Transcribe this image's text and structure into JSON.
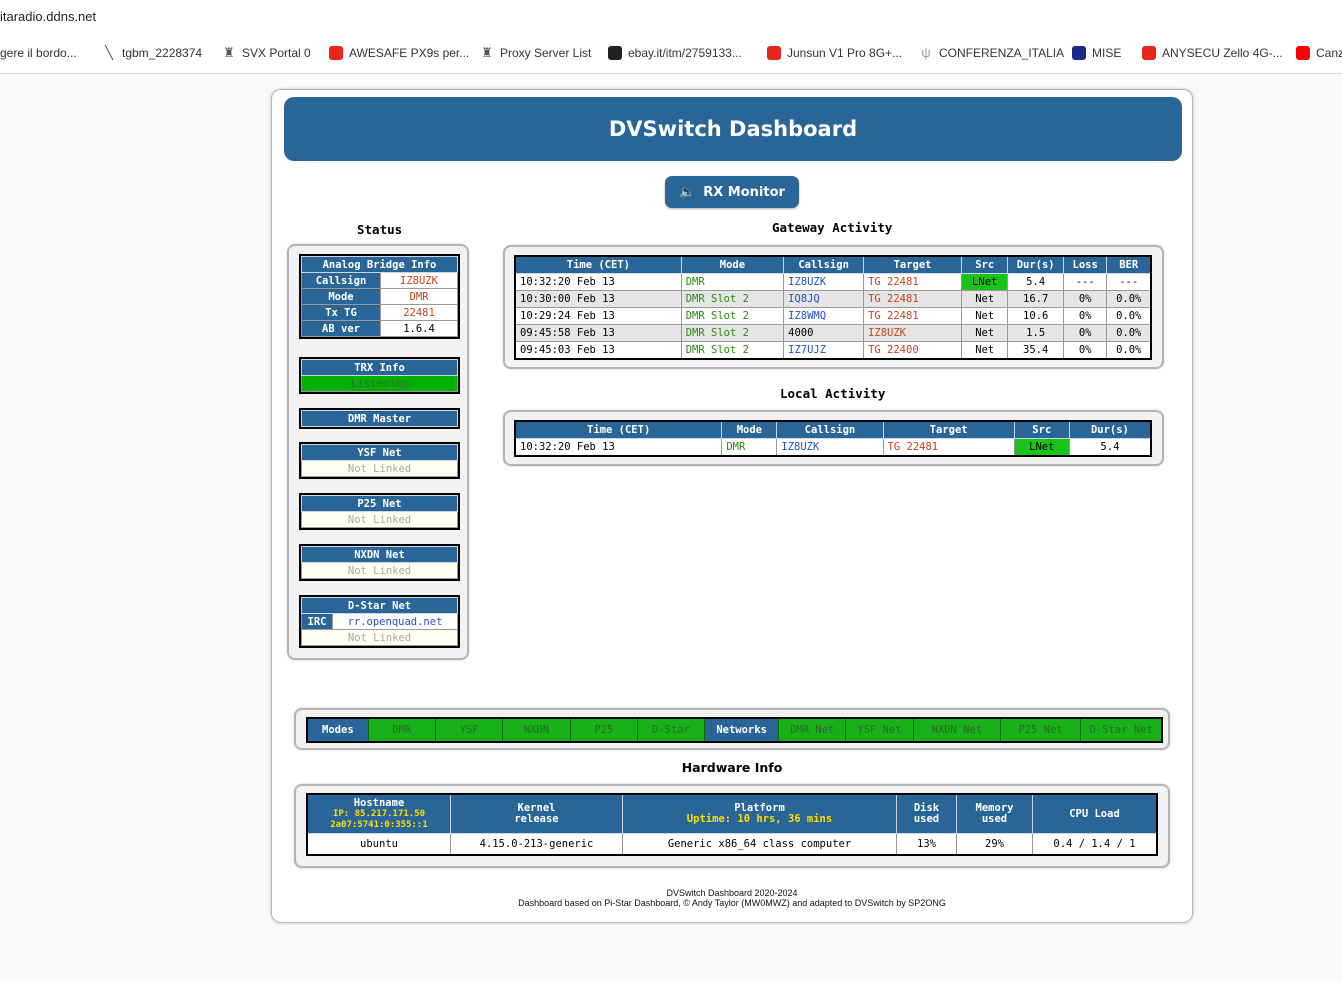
{
  "browser": {
    "url": "itaradio.ddns.net",
    "bookmarks": [
      {
        "label": "gere il bordo...",
        "icon": "none-icon"
      },
      {
        "label": "tgbm_2228374",
        "icon": "needle-icon"
      },
      {
        "label": "SVX Portal 0",
        "icon": "tower-icon"
      },
      {
        "label": "AWESAFE PX9s per...",
        "icon": "aliexpress-icon"
      },
      {
        "label": "Proxy Server List",
        "icon": "tower-icon"
      },
      {
        "label": "ebay.it/itm/2759133...",
        "icon": "bag-icon"
      },
      {
        "label": "Junsun V1 Pro 8G+...",
        "icon": "aliexpress-icon"
      },
      {
        "label": "CONFERENZA_ITALIA",
        "icon": "antenna-icon"
      },
      {
        "label": "MISE",
        "icon": "mise-icon"
      },
      {
        "label": "ANYSECU Zello 4G-...",
        "icon": "aliexpress-icon"
      },
      {
        "label": "Canz",
        "icon": "youtube-icon"
      }
    ]
  },
  "header": {
    "title": "DVSwitch Dashboard"
  },
  "rx_button": {
    "label": "RX Monitor"
  },
  "status": {
    "title": "Status",
    "analog_bridge": {
      "heading": "Analog Bridge Info",
      "rows": [
        {
          "k": "Callsign",
          "v": "IZ8UZK"
        },
        {
          "k": "Mode",
          "v": "DMR"
        },
        {
          "k": "Tx TG",
          "v": "22481"
        },
        {
          "k": "AB ver",
          "v": "1.6.4"
        }
      ]
    },
    "trx": {
      "heading": "TRX Info",
      "state": "Listening"
    },
    "dmr_master": {
      "heading": "DMR Master"
    },
    "ysf": {
      "heading": "YSF Net",
      "state": "Not Linked"
    },
    "p25": {
      "heading": "P25 Net",
      "state": "Not Linked"
    },
    "nxdn": {
      "heading": "NXDN Net",
      "state": "Not Linked"
    },
    "dstar": {
      "heading": "D-Star Net",
      "irc_label": "IRC",
      "irc_value": "rr.openquad.net",
      "state": "Not Linked"
    }
  },
  "gateway": {
    "title": "Gateway Activity",
    "headers": [
      "Time (CET)",
      "Mode",
      "Callsign",
      "Target",
      "Src",
      "Dur(s)",
      "Loss",
      "BER"
    ],
    "rows": [
      {
        "time": "10:32:20 Feb 13",
        "mode": "DMR",
        "call": "IZ8UZK",
        "target": "TG 22481",
        "src": "LNet",
        "dur": "5.4",
        "loss": "---",
        "ber": "---"
      },
      {
        "time": "10:30:00 Feb 13",
        "mode": "DMR Slot 2",
        "call": "IQ8JQ",
        "target": "TG 22481",
        "src": "Net",
        "dur": "16.7",
        "loss": "0%",
        "ber": "0.0%"
      },
      {
        "time": "10:29:24 Feb 13",
        "mode": "DMR Slot 2",
        "call": "IZ8WMQ",
        "target": "TG 22481",
        "src": "Net",
        "dur": "10.6",
        "loss": "0%",
        "ber": "0.0%"
      },
      {
        "time": "09:45:58 Feb 13",
        "mode": "DMR Slot 2",
        "call": "4000",
        "target": "IZ8UZK",
        "src": "Net",
        "dur": "1.5",
        "loss": "0%",
        "ber": "0.0%"
      },
      {
        "time": "09:45:03 Feb 13",
        "mode": "DMR Slot 2",
        "call": "IZ7UJZ",
        "target": "TG 22400",
        "src": "Net",
        "dur": "35.4",
        "loss": "0%",
        "ber": "0.0%"
      }
    ]
  },
  "local": {
    "title": "Local Activity",
    "headers": [
      "Time (CET)",
      "Mode",
      "Callsign",
      "Target",
      "Src",
      "Dur(s)"
    ],
    "rows": [
      {
        "time": "10:32:20 Feb 13",
        "mode": "DMR",
        "call": "IZ8UZK",
        "target": "TG 22481",
        "src": "LNet",
        "dur": "5.4"
      }
    ]
  },
  "modes_bar": {
    "modes_label": "Modes",
    "modes": [
      "DMR",
      "YSF",
      "NXDN",
      "P25",
      "D-Star"
    ],
    "networks_label": "Networks",
    "networks": [
      "DMR Net",
      "YSF Net",
      "NXDN Net",
      "P25 Net",
      "D-Star Net"
    ]
  },
  "hardware": {
    "title": "Hardware Info",
    "hostname_label": "Hostname",
    "ip": "IP: 85.217.171.50",
    "ipv6": "2a07:5741:0:355::1",
    "kernel_label1": "Kernel",
    "kernel_label2": "release",
    "platform_label": "Platform",
    "uptime": "Uptime: 10 hrs, 36 mins",
    "disk_label1": "Disk",
    "disk_label2": "used",
    "mem_label1": "Memory",
    "mem_label2": "used",
    "cpu_label": "CPU Load",
    "hostname": "ubuntu",
    "kernel": "4.15.0-213-generic",
    "platform": "Generic x86_64 class computer",
    "disk": "13%",
    "memory": "29%",
    "cpu": "0.4 / 1.4 / 1"
  },
  "footer": {
    "line1": "DVSwitch Dashboard 2020-2024",
    "line2": "Dashboard based on Pi-Star Dashboard, © Andy Taylor (MW0MWZ) and adapted to DVSwitch by SP2ONG"
  }
}
